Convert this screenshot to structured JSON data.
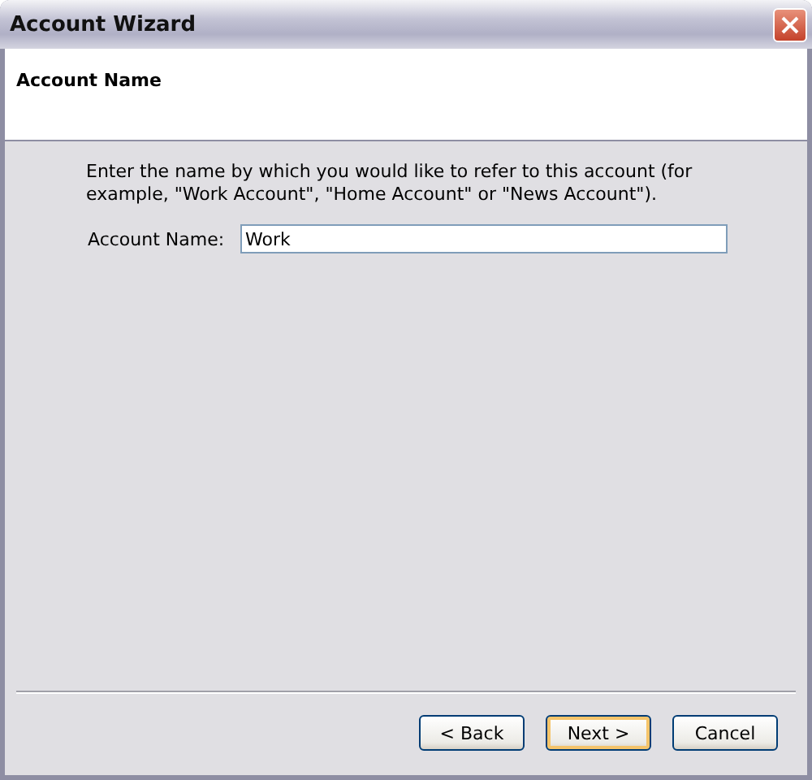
{
  "window": {
    "title": "Account Wizard"
  },
  "header": {
    "title": "Account Name"
  },
  "description": "Enter the name by which you would like to refer to this account (for example, \"Work Account\", \"Home Account\" or \"News Account\").",
  "field": {
    "label": "Account Name:",
    "value": "Work"
  },
  "buttons": [
    {
      "label": "< Back",
      "default": false
    },
    {
      "label": "Next >",
      "default": true
    },
    {
      "label": "Cancel",
      "default": false
    }
  ]
}
